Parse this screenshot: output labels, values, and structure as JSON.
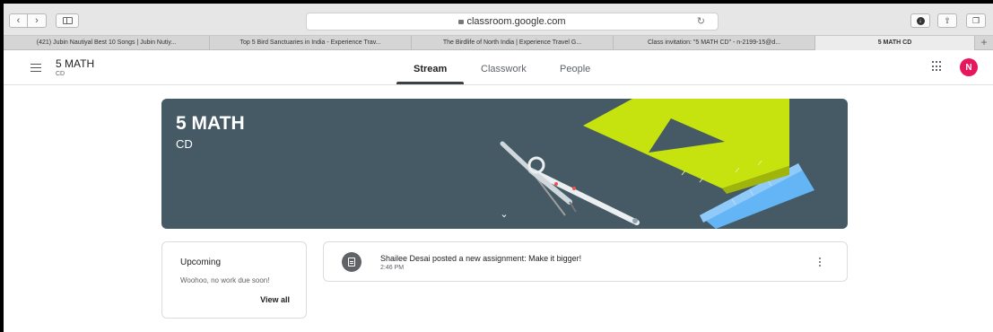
{
  "browser": {
    "url": "classroom.google.com",
    "tabs": [
      "(421) Jubin Nautiyal Best 10 Songs | Jubin Nutiy...",
      "Top 5 Bird Sanctuaries in India - Experience Trav...",
      "The Birdlife of North India | Experience Travel G...",
      "Class invitation: \"5 MATH CD\" - n-2199-15@d...",
      "5 MATH CD"
    ],
    "new_tab": "+"
  },
  "header": {
    "class_name": "5 MATH",
    "class_section": "CD",
    "nav": [
      "Stream",
      "Classwork",
      "People"
    ],
    "avatar_initial": "N",
    "avatar_color": "#e8175d"
  },
  "banner": {
    "title": "5 MATH",
    "subtitle": "CD",
    "color": "#455a64"
  },
  "upcoming": {
    "title": "Upcoming",
    "message": "Woohoo, no work due soon!",
    "link": "View all"
  },
  "stream": [
    {
      "text": "Shailee Desai posted a new assignment: Make it bigger!",
      "time": "2:46 PM",
      "icon": "assignment-icon"
    }
  ]
}
